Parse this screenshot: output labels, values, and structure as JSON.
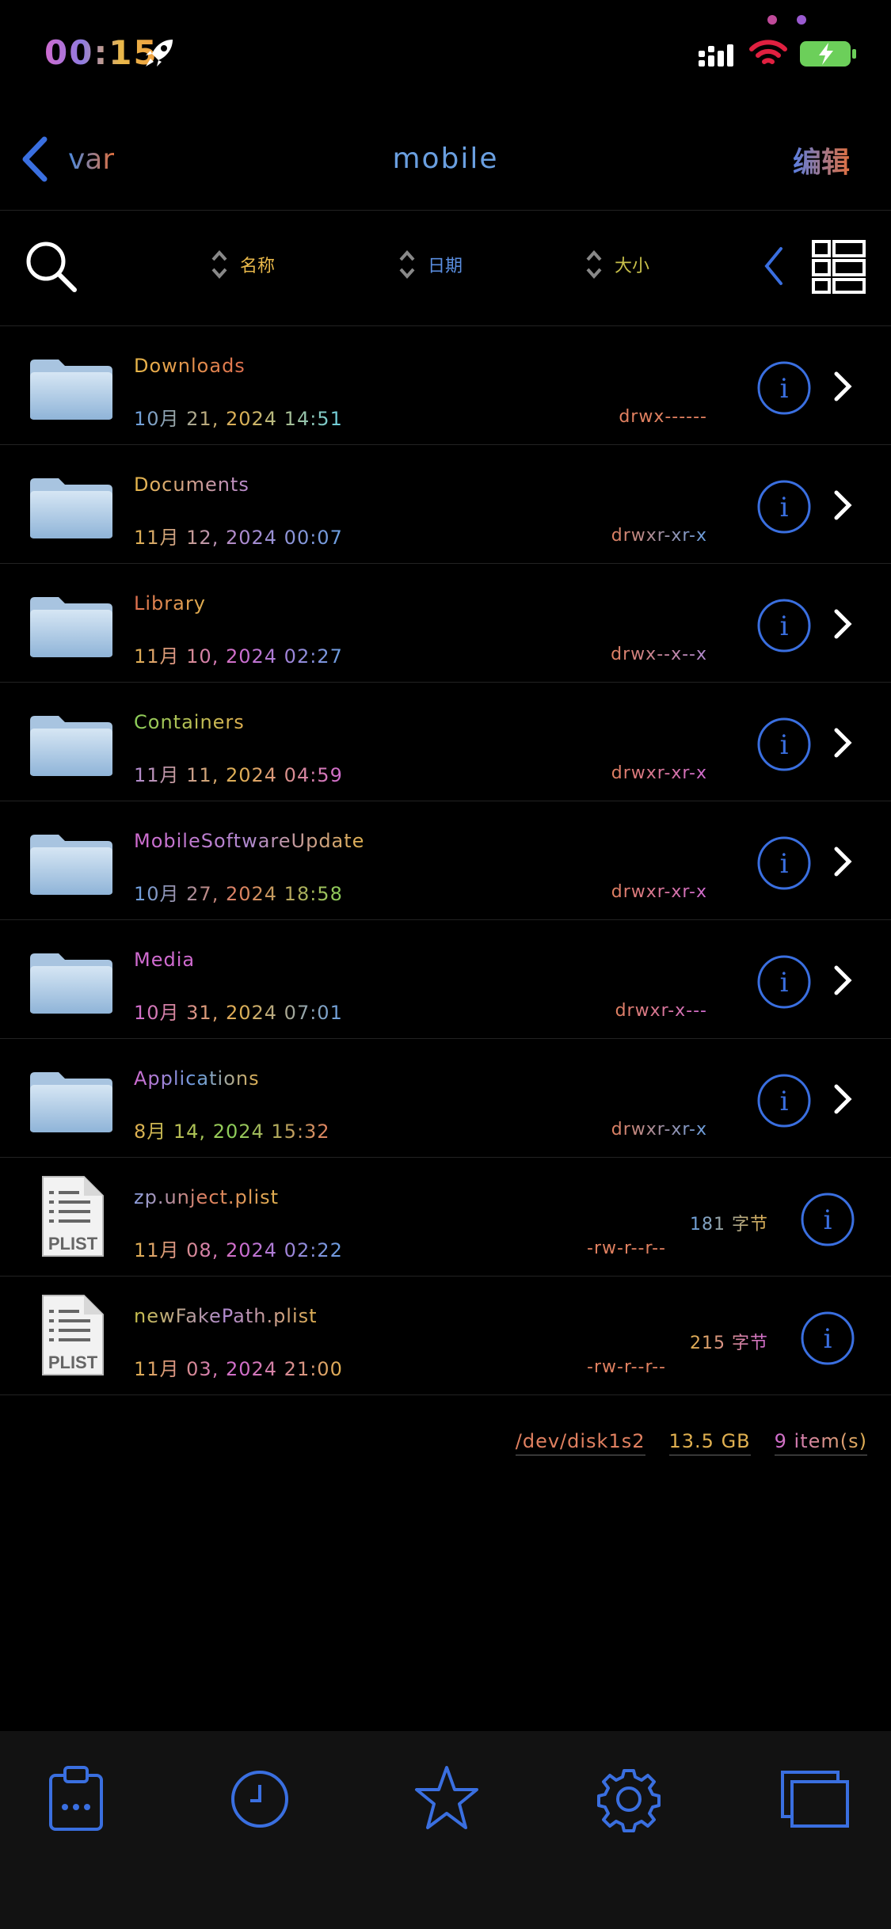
{
  "status": {
    "time": "00:15",
    "icons": [
      "rocket-icon",
      "signal-icon",
      "wifi-icon",
      "battery-charging-icon"
    ]
  },
  "nav": {
    "back_label": "var",
    "title": "mobile",
    "edit_label": "编辑"
  },
  "toolbar": {
    "sort_name": "名称",
    "sort_date": "日期",
    "sort_size": "大小"
  },
  "files": [
    {
      "name": "Downloads",
      "date": "10月 21, 2024 14:51",
      "perm": "drwx------",
      "type": "folder"
    },
    {
      "name": "Documents",
      "date": "11月 12, 2024 00:07",
      "perm": "drwxr-xr-x",
      "type": "folder"
    },
    {
      "name": "Library",
      "date": "11月 10, 2024 02:27",
      "perm": "drwx--x--x",
      "type": "folder"
    },
    {
      "name": "Containers",
      "date": "11月 11, 2024 04:59",
      "perm": "drwxr-xr-x",
      "type": "folder"
    },
    {
      "name": "MobileSoftwareUpdate",
      "date": "10月 27, 2024 18:58",
      "perm": "drwxr-xr-x",
      "type": "folder"
    },
    {
      "name": "Media",
      "date": "10月 31, 2024 07:01",
      "perm": "drwxr-x---",
      "type": "folder"
    },
    {
      "name": "Applications",
      "date": "8月 14, 2024 15:32",
      "perm": "drwxr-xr-x",
      "type": "folder"
    },
    {
      "name": "zp.unject.plist",
      "date": "11月 08, 2024 02:22",
      "perm": "-rw-r--r--",
      "size": "181 字节",
      "type": "file",
      "badge": "PLIST"
    },
    {
      "name": "newFakePath.plist",
      "date": "11月 03, 2024 21:00",
      "perm": "-rw-r--r--",
      "size": "215 字节",
      "type": "file",
      "badge": "PLIST"
    }
  ],
  "footer": {
    "disk": "/dev/disk1s2",
    "free": "13.5 GB",
    "count": "9 item(s)"
  },
  "tabs": [
    "clipboard-icon",
    "clock-icon",
    "star-icon",
    "gear-icon",
    "windows-icon"
  ],
  "colors": {
    "accent": "#3a6fe0",
    "background": "#000000",
    "tabbar": "#121212"
  }
}
